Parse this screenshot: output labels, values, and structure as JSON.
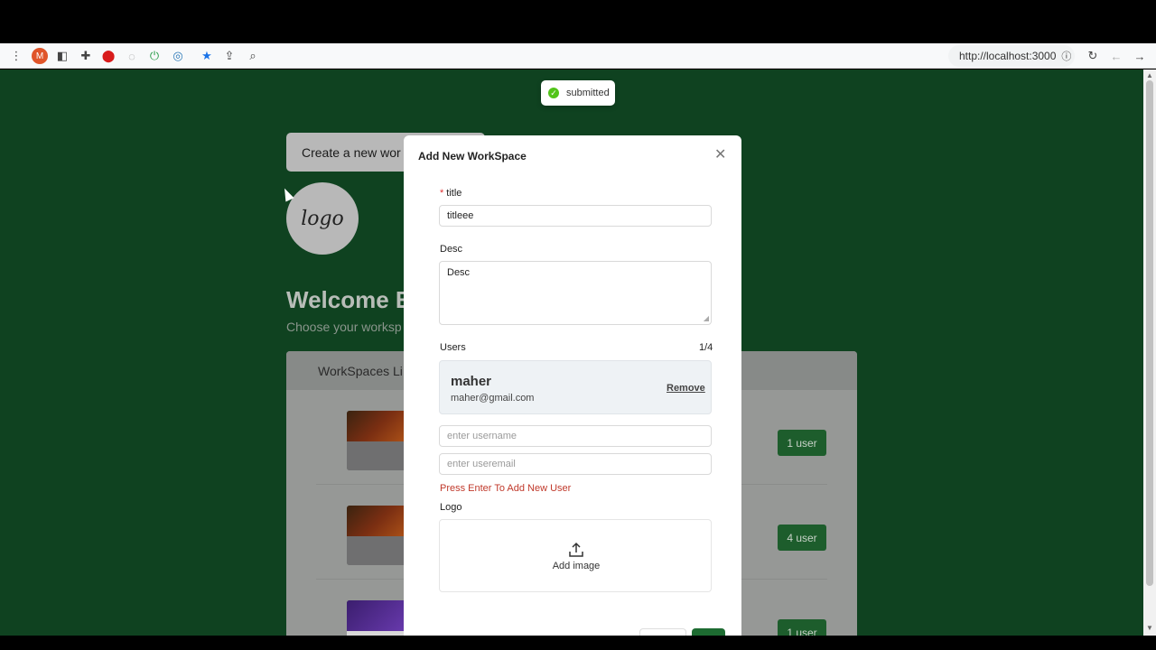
{
  "browser": {
    "url": "http://localhost:3000",
    "extension_initial": "M"
  },
  "page": {
    "create_button_label": "Create a new wor",
    "logo_text": "logo",
    "welcome_text": "Welcome E",
    "choose_text": "Choose your worksp",
    "workspaces_title": "WorkSpaces Li",
    "rows": [
      {
        "badge": "1 user"
      },
      {
        "badge": "4 user"
      },
      {
        "badge": "1 user"
      }
    ]
  },
  "toast": {
    "message": "submitted"
  },
  "modal": {
    "title": "Add New WorkSpace",
    "title_field": {
      "label": "title",
      "value": "titleee"
    },
    "desc_field": {
      "label": "Desc",
      "value": "Desc"
    },
    "users": {
      "label": "Users",
      "count": "1/4",
      "list": [
        {
          "name": "maher",
          "email": "maher@gmail.com",
          "remove_label": "Remove"
        }
      ],
      "username_placeholder": "enter username",
      "useremail_placeholder": "enter useremail",
      "hint": "Press Enter To Add New User"
    },
    "logo": {
      "label": "Logo",
      "upload_label": "Add image"
    }
  },
  "colors": {
    "page_background": "#0f4220",
    "primary": "#1d6b31",
    "error": "#c0392b",
    "success": "#52c41a"
  }
}
